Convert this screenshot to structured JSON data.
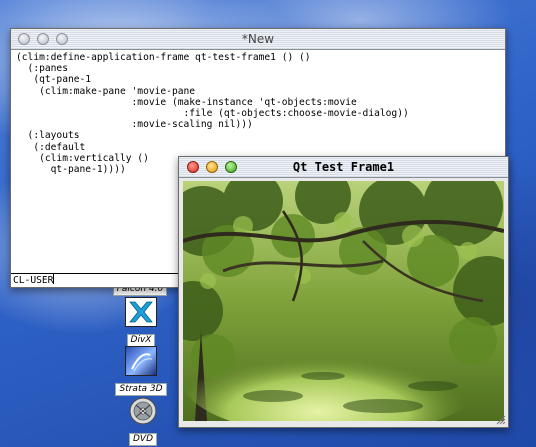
{
  "desktop": {
    "icons": [
      {
        "label": "Falcon 4.0",
        "name": "falcon-icon"
      },
      {
        "label": "DivX",
        "name": "divx-icon"
      },
      {
        "label": "Strata 3D",
        "name": "strata-3d-icon"
      },
      {
        "label": "DVD",
        "name": "dvd-icon"
      }
    ]
  },
  "editor": {
    "title": "*New",
    "code": "(clim:define-application-frame qt-test-frame1 () ()\n  (:panes\n   (qt-pane-1\n    (clim:make-pane 'movie-pane\n                    :movie (make-instance 'qt-objects:movie\n                             :file (qt-objects:choose-movie-dialog))\n                    :movie-scaling nil)))\n  (:layouts\n   (:default\n    (clim:vertically ()\n      qt-pane-1))))",
    "minibuffer": "CL-USER"
  },
  "qt_frame": {
    "title": "Qt Test Frame1",
    "content": "forest-path-movie-frame"
  },
  "colors": {
    "desktop_blue": "#2f63c8",
    "close_red": "#d8271b",
    "minimize_yellow": "#e09b0b",
    "zoom_green": "#3ba51c"
  }
}
